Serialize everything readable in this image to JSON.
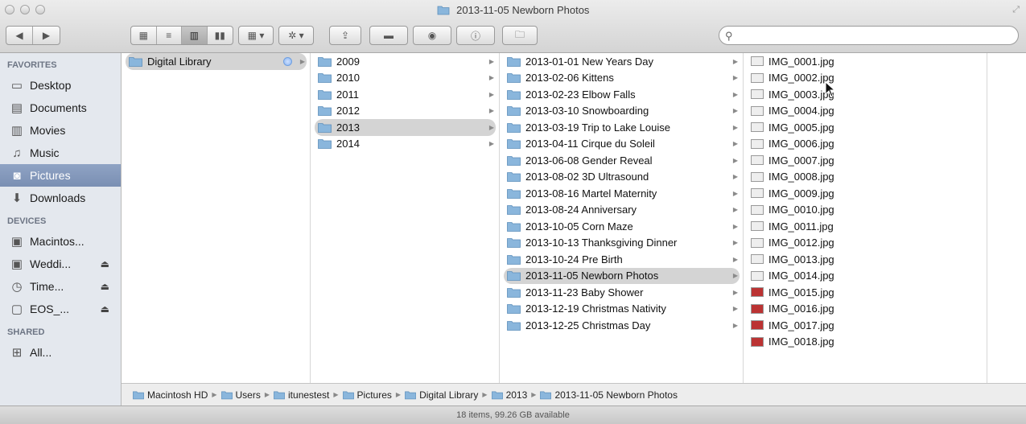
{
  "window": {
    "title": "2013-11-05 Newborn Photos"
  },
  "toolbar": {
    "search_placeholder": "",
    "back_icon": "back-arrow-icon",
    "forward_icon": "forward-arrow-icon"
  },
  "sidebar": {
    "favorites_header": "FAVORITES",
    "favorites": [
      {
        "label": "Desktop",
        "icon": "desktop-icon"
      },
      {
        "label": "Documents",
        "icon": "documents-icon"
      },
      {
        "label": "Movies",
        "icon": "movies-icon"
      },
      {
        "label": "Music",
        "icon": "music-icon"
      },
      {
        "label": "Pictures",
        "icon": "pictures-icon",
        "selected": true
      },
      {
        "label": "Downloads",
        "icon": "downloads-icon"
      }
    ],
    "devices_header": "DEVICES",
    "devices": [
      {
        "label": "Macintos...",
        "eject": false
      },
      {
        "label": "Weddi...",
        "eject": true
      },
      {
        "label": "Time...",
        "eject": true
      },
      {
        "label": "EOS_...",
        "eject": true
      }
    ],
    "shared_header": "SHARED",
    "shared": [
      {
        "label": "All..."
      }
    ]
  },
  "columns": {
    "col1": [
      "Digital Library"
    ],
    "col2": [
      "2009",
      "2010",
      "2011",
      "2012",
      "2013",
      "2014"
    ],
    "col3": [
      "2013-01-01 New Years Day",
      "2013-02-06 Kittens",
      "2013-02-23 Elbow Falls",
      "2013-03-10 Snowboarding",
      "2013-03-19 Trip to Lake Louise",
      "2013-04-11 Cirque du Soleil",
      "2013-06-08 Gender Reveal",
      "2013-08-02 3D Ultrasound",
      "2013-08-16 Martel Maternity",
      "2013-08-24 Anniversary",
      "2013-10-05 Corn Maze",
      "2013-10-13 Thanksgiving Dinner",
      "2013-10-24 Pre Birth",
      "2013-11-05 Newborn Photos",
      "2013-11-23 Baby Shower",
      "2013-12-19 Christmas Nativity",
      "2013-12-25 Christmas Day"
    ],
    "col4": [
      "IMG_0001.jpg",
      "IMG_0002.jpg",
      "IMG_0003.jpg",
      "IMG_0004.jpg",
      "IMG_0005.jpg",
      "IMG_0006.jpg",
      "IMG_0007.jpg",
      "IMG_0008.jpg",
      "IMG_0009.jpg",
      "IMG_0010.jpg",
      "IMG_0011.jpg",
      "IMG_0012.jpg",
      "IMG_0013.jpg",
      "IMG_0014.jpg",
      "IMG_0015.jpg",
      "IMG_0016.jpg",
      "IMG_0017.jpg",
      "IMG_0018.jpg"
    ]
  },
  "pathbar": [
    "Macintosh HD",
    "Users",
    "itunestest",
    "Pictures",
    "Digital Library",
    "2013",
    "2013-11-05 Newborn Photos"
  ],
  "status": "18 items, 99.26 GB available",
  "colors": {
    "folder": "#8ab6dc",
    "sidebar_bg": "#e4e8ee",
    "selection": "#7a8fb3"
  }
}
